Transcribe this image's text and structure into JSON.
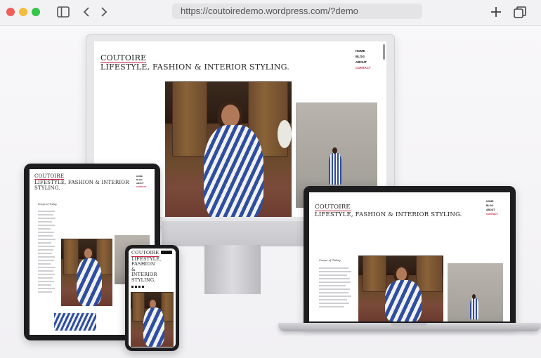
{
  "browser": {
    "url": "https://coutoiredemo.wordpress.com/?demo",
    "colors": {
      "close": "#ee5f57",
      "minimize": "#f6bd3c",
      "zoom": "#36c748"
    },
    "icons": {
      "sidebar": "sidebar-toggle-icon",
      "back": "chevron-left-icon",
      "forward": "chevron-right-icon",
      "new_tab": "plus-icon",
      "tabs": "tabs-overview-icon"
    }
  },
  "site": {
    "brand": "COUTOIRE",
    "tagline": "LIFESTYLE, FASHION & INTERIOR STYLING.",
    "nav": [
      "HOME",
      "BLOG",
      "ABOUT",
      "CONTACT"
    ],
    "active_nav": "CONTACT",
    "accent": "#cc2244",
    "sidebar_heading": "Snaps of Today",
    "phone_title_lines": [
      "COUTOIRE",
      "LIFESTYLE,",
      "FASHION",
      "&",
      "INTERIOR",
      "STYLING."
    ],
    "tablet_tagline_lines": [
      "LIFESTYLE, FASHION & INTERIOR",
      "STYLING."
    ]
  }
}
